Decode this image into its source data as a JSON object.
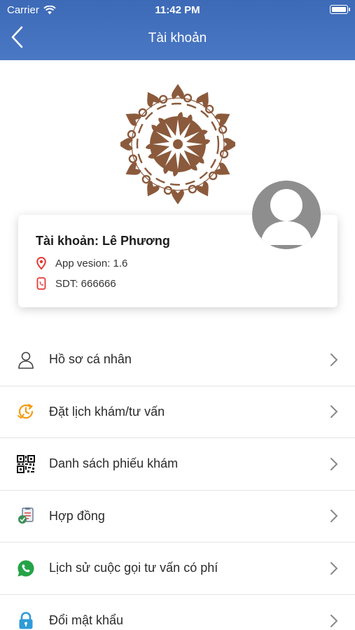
{
  "status_bar": {
    "carrier": "Carrier",
    "time": "11:42 PM"
  },
  "nav": {
    "title": "Tài khoản",
    "back_icon": "chevron-left-icon"
  },
  "account": {
    "title": "Tài khoản: Lê Phương",
    "version": "App vesion: 1.6",
    "phone": "SDT: 666666"
  },
  "menu": {
    "items": [
      {
        "label": "Hồ sơ cá nhân",
        "icon": "person-icon"
      },
      {
        "label": "Đặt lịch khám/tư vấn",
        "icon": "clock-icon"
      },
      {
        "label": "Danh sách phiếu khám",
        "icon": "qr-code-icon"
      },
      {
        "label": "Hợp đồng",
        "icon": "contract-icon"
      },
      {
        "label": "Lịch sử cuộc gọi tư vấn có phí",
        "icon": "whatsapp-icon"
      },
      {
        "label": "Đổi mật khẩu",
        "icon": "lock-icon"
      }
    ]
  },
  "colors": {
    "header": "#4572bd",
    "logo": "#8b5a3c",
    "location_pin": "#e53935",
    "clock": "#f39c12",
    "whatsapp": "#25a348",
    "lock": "#2f9bd8"
  }
}
